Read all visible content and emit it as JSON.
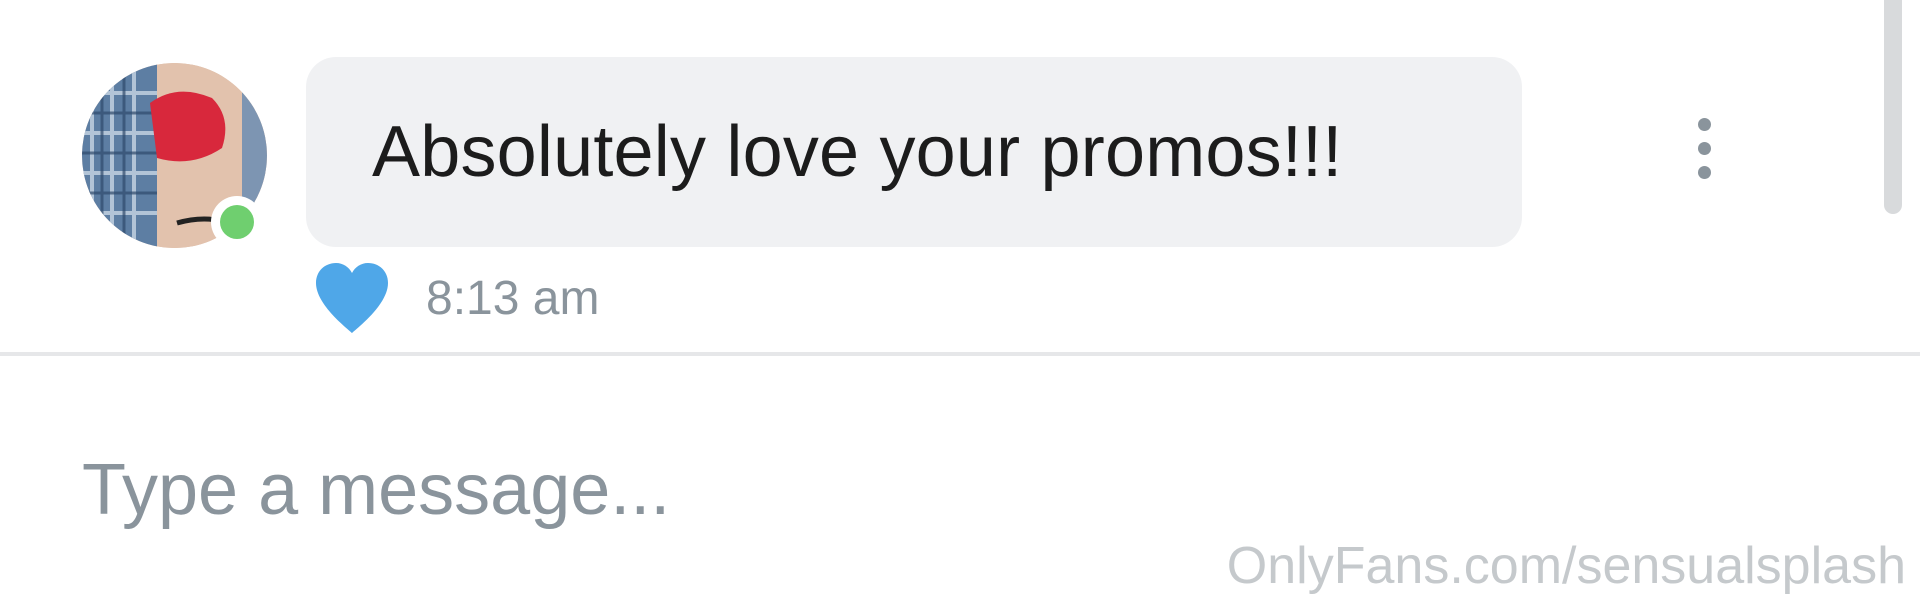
{
  "message": {
    "text": "Absolutely love your promos!!!",
    "time": "8:13 am",
    "liked": true,
    "sender_online": true
  },
  "composer": {
    "placeholder": "Type a message..."
  },
  "watermark": "OnlyFans.com/sensualsplash",
  "colors": {
    "bubble_bg": "#f0f1f3",
    "heart": "#4fa7e8",
    "online_status": "#6fcf6f",
    "muted_text": "#8a949c"
  },
  "icons": {
    "like": "heart-icon",
    "more": "kebab-menu-icon"
  }
}
